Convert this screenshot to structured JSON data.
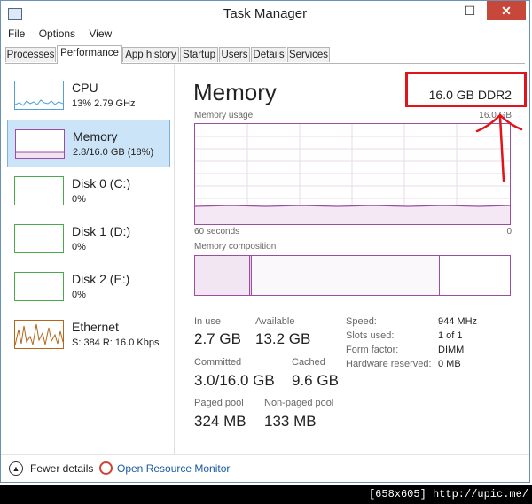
{
  "window": {
    "title": "Task Manager",
    "buttons": {
      "minimize": "—",
      "maximize": "☐",
      "close": "✕"
    }
  },
  "menu": [
    "File",
    "Options",
    "View"
  ],
  "tabs": [
    "Processes",
    "Performance",
    "App history",
    "Startup",
    "Users",
    "Details",
    "Services"
  ],
  "active_tab": "Performance",
  "resources": [
    {
      "name": "CPU",
      "detail": "13% 2.79 GHz",
      "color": "#4fa1d6"
    },
    {
      "name": "Memory",
      "detail": "2.8/16.0 GB (18%)",
      "color": "#9b4ea0",
      "selected": true
    },
    {
      "name": "Disk 0 (C:)",
      "detail": "0%",
      "color": "#4ba84b"
    },
    {
      "name": "Disk 1 (D:)",
      "detail": "0%",
      "color": "#4ba84b"
    },
    {
      "name": "Disk 2 (E:)",
      "detail": "0%",
      "color": "#4ba84b"
    },
    {
      "name": "Ethernet",
      "detail": "S: 384 R: 16.0 Kbps",
      "color": "#b5661d"
    }
  ],
  "main": {
    "title": "Memory",
    "spec": "16.0 GB DDR2",
    "usage_label": "Memory usage",
    "usage_max": "16.0 GB",
    "time_left": "60 seconds",
    "time_right": "0",
    "composition_label": "Memory composition",
    "stats": {
      "in_use_label": "In use",
      "in_use": "2.7 GB",
      "available_label": "Available",
      "available": "13.2 GB",
      "committed_label": "Committed",
      "committed": "3.0/16.0 GB",
      "cached_label": "Cached",
      "cached": "9.6 GB",
      "paged_label": "Paged pool",
      "paged": "324 MB",
      "nonpaged_label": "Non-paged pool",
      "nonpaged": "133 MB"
    },
    "details": [
      {
        "label": "Speed:",
        "value": "944 MHz"
      },
      {
        "label": "Slots used:",
        "value": "1 of 1"
      },
      {
        "label": "Form factor:",
        "value": "DIMM"
      },
      {
        "label": "Hardware reserved:",
        "value": "0 MB"
      }
    ]
  },
  "footer": {
    "fewer_details": "Fewer details",
    "open_resource_monitor": "Open Resource Monitor"
  },
  "watermark": "[658x605] http://upic.me/",
  "colors": {
    "memory": "#9b4ea0",
    "accent": "#1a5aa6",
    "annotation": "#e0141b"
  }
}
